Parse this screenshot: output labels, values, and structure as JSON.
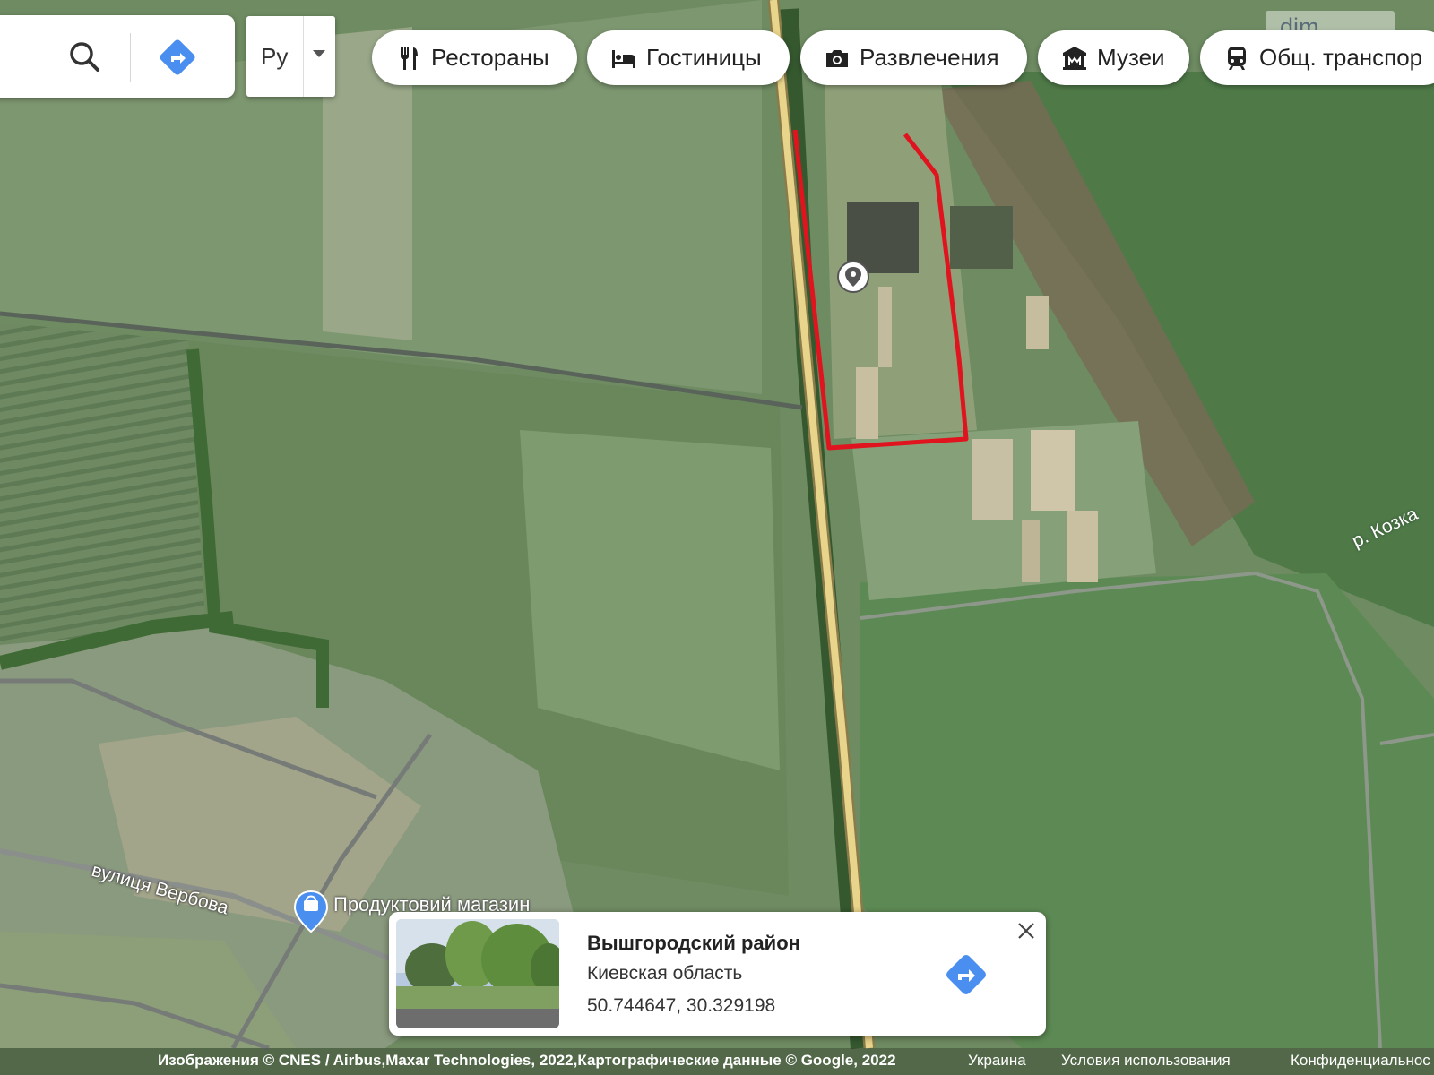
{
  "search": {
    "search_icon": "search-icon",
    "directions_icon": "directions-icon",
    "language": "Ру"
  },
  "chips": [
    {
      "label": "Рестораны",
      "icon": "restaurant-icon"
    },
    {
      "label": "Гостиницы",
      "icon": "hotel-icon"
    },
    {
      "label": "Развлечения",
      "icon": "camera-icon"
    },
    {
      "label": "Музеи",
      "icon": "museum-icon"
    },
    {
      "label": "Общ. транспор",
      "icon": "transit-icon"
    }
  ],
  "map": {
    "watermark": "dim",
    "river_label": "р. Козка",
    "street_label": "вулиця Вербова",
    "poi_label": "Продуктовий магазин",
    "marker_icon": "location-pin-icon",
    "plot_outline_color": "#e0141e"
  },
  "place_card": {
    "title": "Вышгородский район",
    "region": "Киевская область",
    "coordinates": "50.744647, 30.329198",
    "directions_icon": "directions-icon",
    "close_icon": "close-icon"
  },
  "attribution": {
    "imagery": "Изображения © CNES / Airbus,Maxar Technologies, 2022,Картографические данные © Google, 2022",
    "country": "Украина",
    "terms": "Условия использования",
    "privacy": "Конфиденциальнос"
  }
}
